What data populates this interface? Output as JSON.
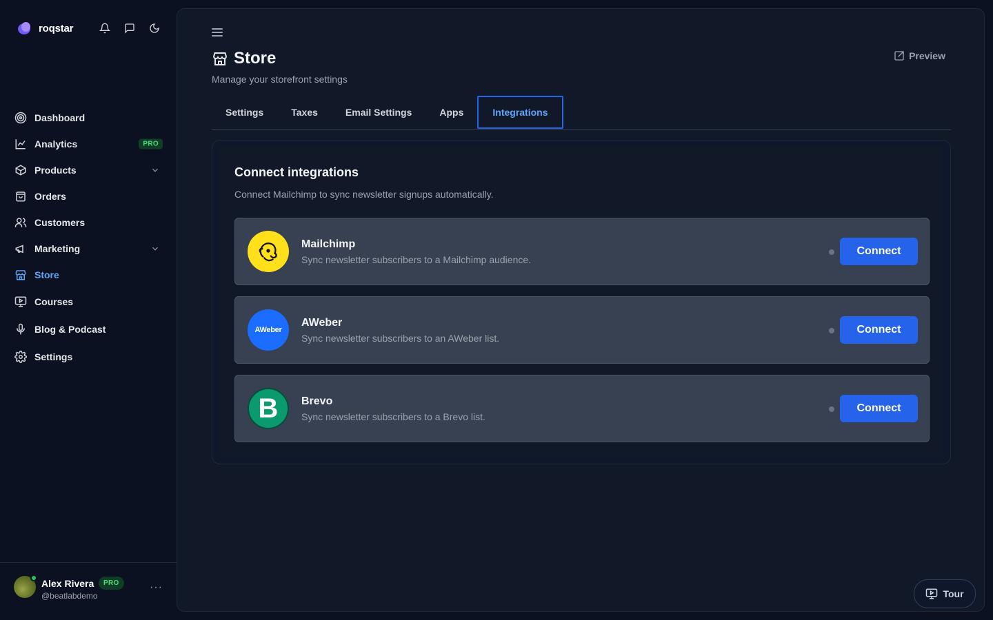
{
  "brand": {
    "name": "roqstar"
  },
  "sidebar": {
    "items": [
      {
        "label": "Dashboard",
        "icon": "dashboard-icon"
      },
      {
        "label": "Analytics",
        "icon": "analytics-icon",
        "badge": "PRO"
      },
      {
        "label": "Products",
        "icon": "products-icon",
        "expandable": true
      },
      {
        "label": "Orders",
        "icon": "orders-icon"
      },
      {
        "label": "Customers",
        "icon": "customers-icon"
      },
      {
        "label": "Marketing",
        "icon": "marketing-icon",
        "expandable": true
      },
      {
        "label": "Store",
        "icon": "store-icon",
        "active": true
      },
      {
        "label": "Courses",
        "icon": "courses-icon"
      },
      {
        "label": "Blog & Podcast",
        "icon": "microphone-icon"
      },
      {
        "label": "Settings",
        "icon": "gear-icon"
      }
    ]
  },
  "user": {
    "name": "Alex Rivera",
    "badge": "PRO",
    "handle": "@beatlabdemo",
    "more": "···"
  },
  "page": {
    "title": "Store",
    "subtitle": "Manage your storefront settings",
    "preview_label": "Preview"
  },
  "tabs": [
    {
      "label": "Settings"
    },
    {
      "label": "Taxes"
    },
    {
      "label": "Email Settings"
    },
    {
      "label": "Apps"
    },
    {
      "label": "Integrations",
      "active": true
    }
  ],
  "integrations": {
    "title": "Connect integrations",
    "description": "Connect Mailchimp to sync newsletter signups automatically.",
    "items": [
      {
        "name": "Mailchimp",
        "description": "Sync newsletter subscribers to a Mailchimp audience.",
        "button": "Connect",
        "logo_color": "#ffe01b"
      },
      {
        "name": "AWeber",
        "description": "Sync newsletter subscribers to an AWeber list.",
        "button": "Connect",
        "logo_color": "#1a6dff",
        "logo_text": "AWeber"
      },
      {
        "name": "Brevo",
        "description": "Sync newsletter subscribers to a Brevo list.",
        "button": "Connect",
        "logo_color": "#0b996e",
        "logo_text": "B"
      }
    ]
  },
  "tour": {
    "label": "Tour"
  },
  "colors": {
    "accent": "#2563eb",
    "active_text": "#60a5fa",
    "pro_green": "#4ade80"
  }
}
